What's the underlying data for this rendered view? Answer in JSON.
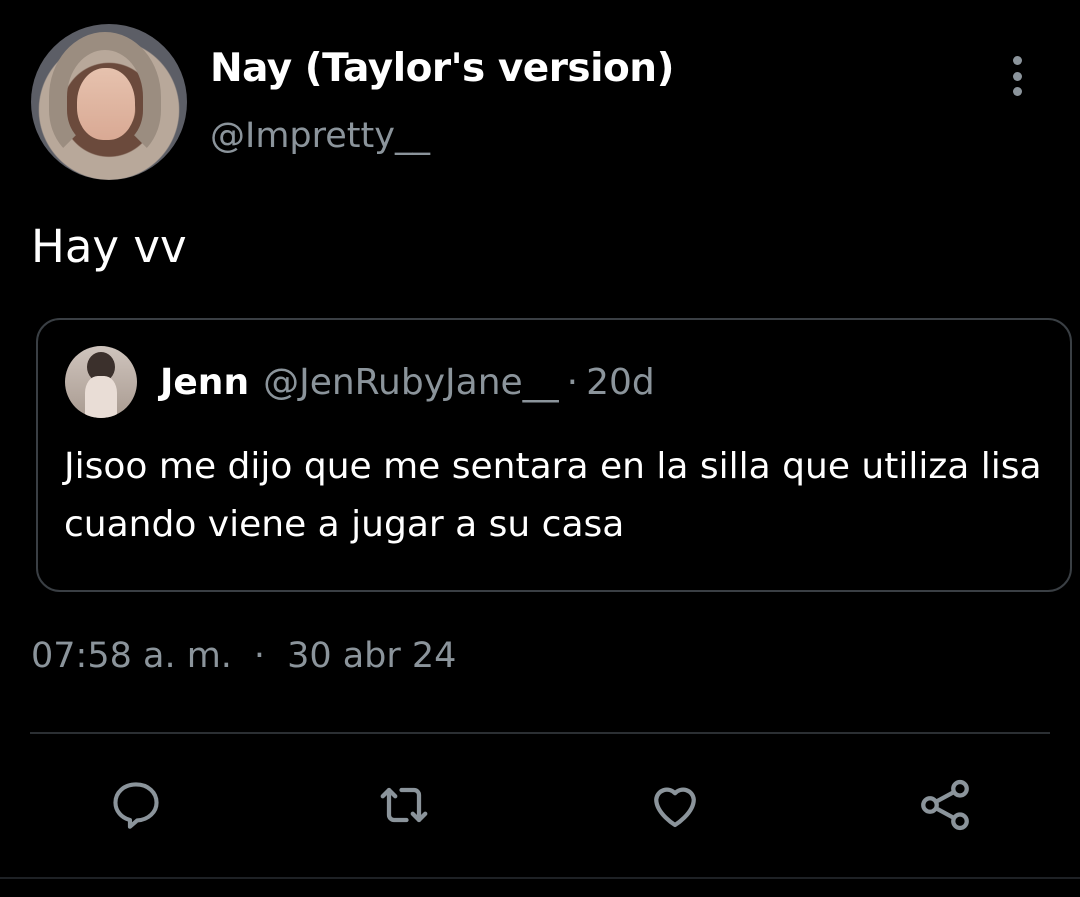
{
  "author": {
    "display_name": "Nay (Taylor's version)",
    "handle": "@Impretty__"
  },
  "tweet": {
    "text": "Hay vv"
  },
  "quoted_tweet": {
    "display_name": "Jenn",
    "handle": "@JenRubyJane__",
    "separator": "·",
    "age": "20d",
    "text": "Jisoo me dijo que me sentara en la silla que utiliza lisa cuando viene a jugar a su casa"
  },
  "meta": {
    "time": "07:58 a. m.",
    "separator": "·",
    "date": "30 abr 24"
  },
  "actions": {
    "icons": [
      "reply-icon",
      "retweet-icon",
      "like-icon",
      "share-icon"
    ]
  },
  "colors": {
    "background": "#000000",
    "primary_text": "#ffffff",
    "secondary_text": "#8b949b",
    "border": "#3a3f44"
  }
}
